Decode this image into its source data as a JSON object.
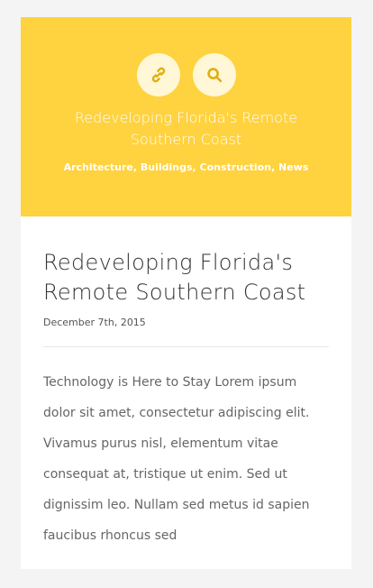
{
  "hero": {
    "link_icon": "link-icon",
    "search_icon": "search-icon",
    "title": "Redeveloping Florida's Remote Southern Coast",
    "categories": "Architecture, Buildings, Construction, News",
    "colors": {
      "background": "#ffd23f",
      "icon_bg": "#fff7d6",
      "icon": "#e0ae12"
    }
  },
  "post": {
    "title": "Redeveloping Florida's Remote Southern Coast",
    "date": "December 7th, 2015",
    "excerpt": "Technology is Here to Stay Lorem ipsum dolor sit amet, consectetur adipiscing elit. Vivamus purus nisl, elementum vitae consequat at, tristique ut enim. Sed ut dignissim leo. Nullam sed metus id sapien faucibus rhoncus sed"
  }
}
